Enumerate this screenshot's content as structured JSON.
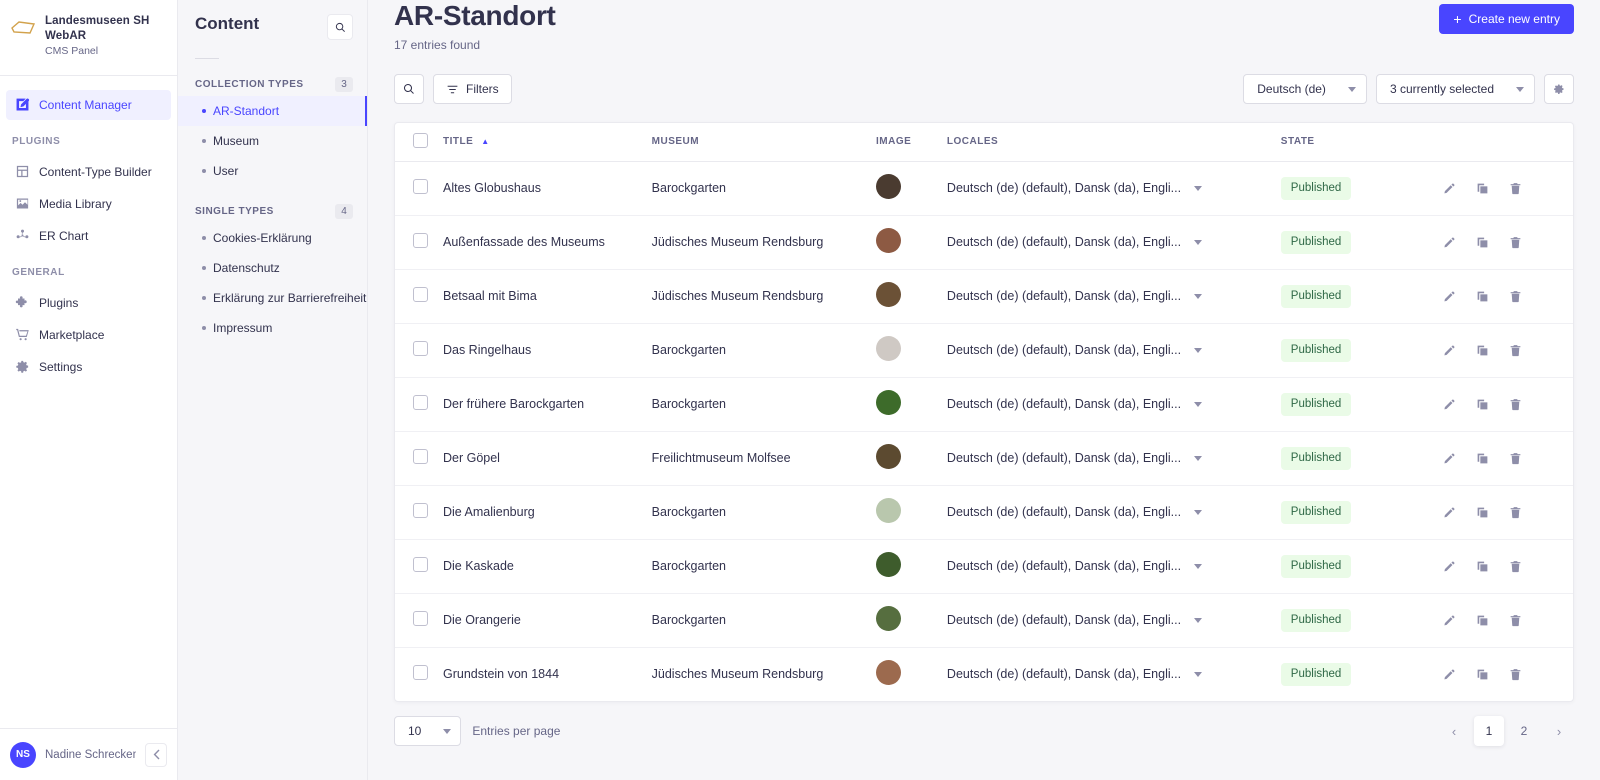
{
  "brand": {
    "title": "Landesmuseen SH WebAR",
    "subtitle": "CMS Panel",
    "logo_icon": "quadrilateral-logo-icon"
  },
  "sidebar": {
    "primary": [
      {
        "label": "Content Manager",
        "icon": "pencil-square-icon",
        "active": true
      }
    ],
    "sections": [
      {
        "label": "PLUGINS",
        "items": [
          {
            "label": "Content-Type Builder",
            "icon": "layout-icon"
          },
          {
            "label": "Media Library",
            "icon": "image-icon"
          },
          {
            "label": "ER Chart",
            "icon": "graph-nodes-icon"
          }
        ]
      },
      {
        "label": "GENERAL",
        "items": [
          {
            "label": "Plugins",
            "icon": "puzzle-icon"
          },
          {
            "label": "Marketplace",
            "icon": "shopping-cart-icon"
          },
          {
            "label": "Settings",
            "icon": "gear-icon"
          }
        ]
      }
    ],
    "footer": {
      "user_initials": "NS",
      "user_name": "Nadine Schrecken",
      "collapse_icon": "chevron-left-icon"
    }
  },
  "subnav": {
    "title": "Content",
    "search_icon": "search-icon",
    "groups": [
      {
        "label": "COLLECTION TYPES",
        "count": "3",
        "items": [
          {
            "label": "AR-Standort",
            "active": true
          },
          {
            "label": "Museum",
            "active": false
          },
          {
            "label": "User",
            "active": false
          }
        ]
      },
      {
        "label": "SINGLE TYPES",
        "count": "4",
        "items": [
          {
            "label": "Cookies-Erklärung",
            "active": false
          },
          {
            "label": "Datenschutz",
            "active": false
          },
          {
            "label": "Erklärung zur Barrierefreiheit",
            "active": false
          },
          {
            "label": "Impressum",
            "active": false
          }
        ]
      }
    ]
  },
  "header": {
    "title": "AR-Standort",
    "subtitle": "17 entries found",
    "create_button": "Create new entry",
    "create_icon": "plus-icon"
  },
  "toolbar": {
    "search_icon": "search-icon",
    "filters_label": "Filters",
    "filters_icon": "filter-icon",
    "locale_select": "Deutsch (de)",
    "fields_select": "3 currently selected",
    "settings_icon": "gear-icon"
  },
  "table": {
    "columns": {
      "title": "TITLE",
      "museum": "MUSEUM",
      "image": "IMAGE",
      "locales": "LOCALES",
      "state": "STATE"
    },
    "sort_indicator": "▲",
    "rows": [
      {
        "title": "Altes Globushaus",
        "museum": "Barockgarten",
        "locales": "Deutsch (de) (default), Dansk (da), Engli...",
        "state": "Published",
        "thumb": "#4a3b30"
      },
      {
        "title": "Außenfassade des Museums",
        "museum": "Jüdisches Museum Rendsburg",
        "locales": "Deutsch (de) (default), Dansk (da), Engli...",
        "state": "Published",
        "thumb": "#8d5a43"
      },
      {
        "title": "Betsaal mit Bima",
        "museum": "Jüdisches Museum Rendsburg",
        "locales": "Deutsch (de) (default), Dansk (da), Engli...",
        "state": "Published",
        "thumb": "#6b5136"
      },
      {
        "title": "Das Ringelhaus",
        "museum": "Barockgarten",
        "locales": "Deutsch (de) (default), Dansk (da), Engli...",
        "state": "Published",
        "thumb": "#cfc9c4"
      },
      {
        "title": "Der frühere Barockgarten",
        "museum": "Barockgarten",
        "locales": "Deutsch (de) (default), Dansk (da), Engli...",
        "state": "Published",
        "thumb": "#3d6b2a"
      },
      {
        "title": "Der Göpel",
        "museum": "Freilichtmuseum Molfsee",
        "locales": "Deutsch (de) (default), Dansk (da), Engli...",
        "state": "Published",
        "thumb": "#5c4a30"
      },
      {
        "title": "Die Amalienburg",
        "museum": "Barockgarten",
        "locales": "Deutsch (de) (default), Dansk (da), Engli...",
        "state": "Published",
        "thumb": "#b9c7ad"
      },
      {
        "title": "Die Kaskade",
        "museum": "Barockgarten",
        "locales": "Deutsch (de) (default), Dansk (da), Engli...",
        "state": "Published",
        "thumb": "#3e5c2c"
      },
      {
        "title": "Die Orangerie",
        "museum": "Barockgarten",
        "locales": "Deutsch (de) (default), Dansk (da), Engli...",
        "state": "Published",
        "thumb": "#566e3f"
      },
      {
        "title": "Grundstein von 1844",
        "museum": "Jüdisches Museum Rendsburg",
        "locales": "Deutsch (de) (default), Dansk (da), Engli...",
        "state": "Published",
        "thumb": "#9c6a4e"
      }
    ],
    "row_actions": {
      "edit_icon": "pencil-icon",
      "duplicate_icon": "duplicate-icon",
      "delete_icon": "trash-icon"
    },
    "locale_dropdown_icon": "chevron-down-icon"
  },
  "footer": {
    "entries_per_page_value": "10",
    "entries_per_page_label": "Entries per page",
    "prev_icon": "chevron-left-icon",
    "next_icon": "chevron-right-icon",
    "pages": [
      "1",
      "2"
    ],
    "active_page": "1"
  },
  "colors": {
    "accent": "#4945ff",
    "accent_bg": "#f0f0ff",
    "page_bg": "#f6f6f9",
    "text": "#32324d",
    "muted": "#666687",
    "badge_bg": "#eafbe7",
    "badge_text": "#2f6846",
    "logo": "#d2a24c"
  }
}
